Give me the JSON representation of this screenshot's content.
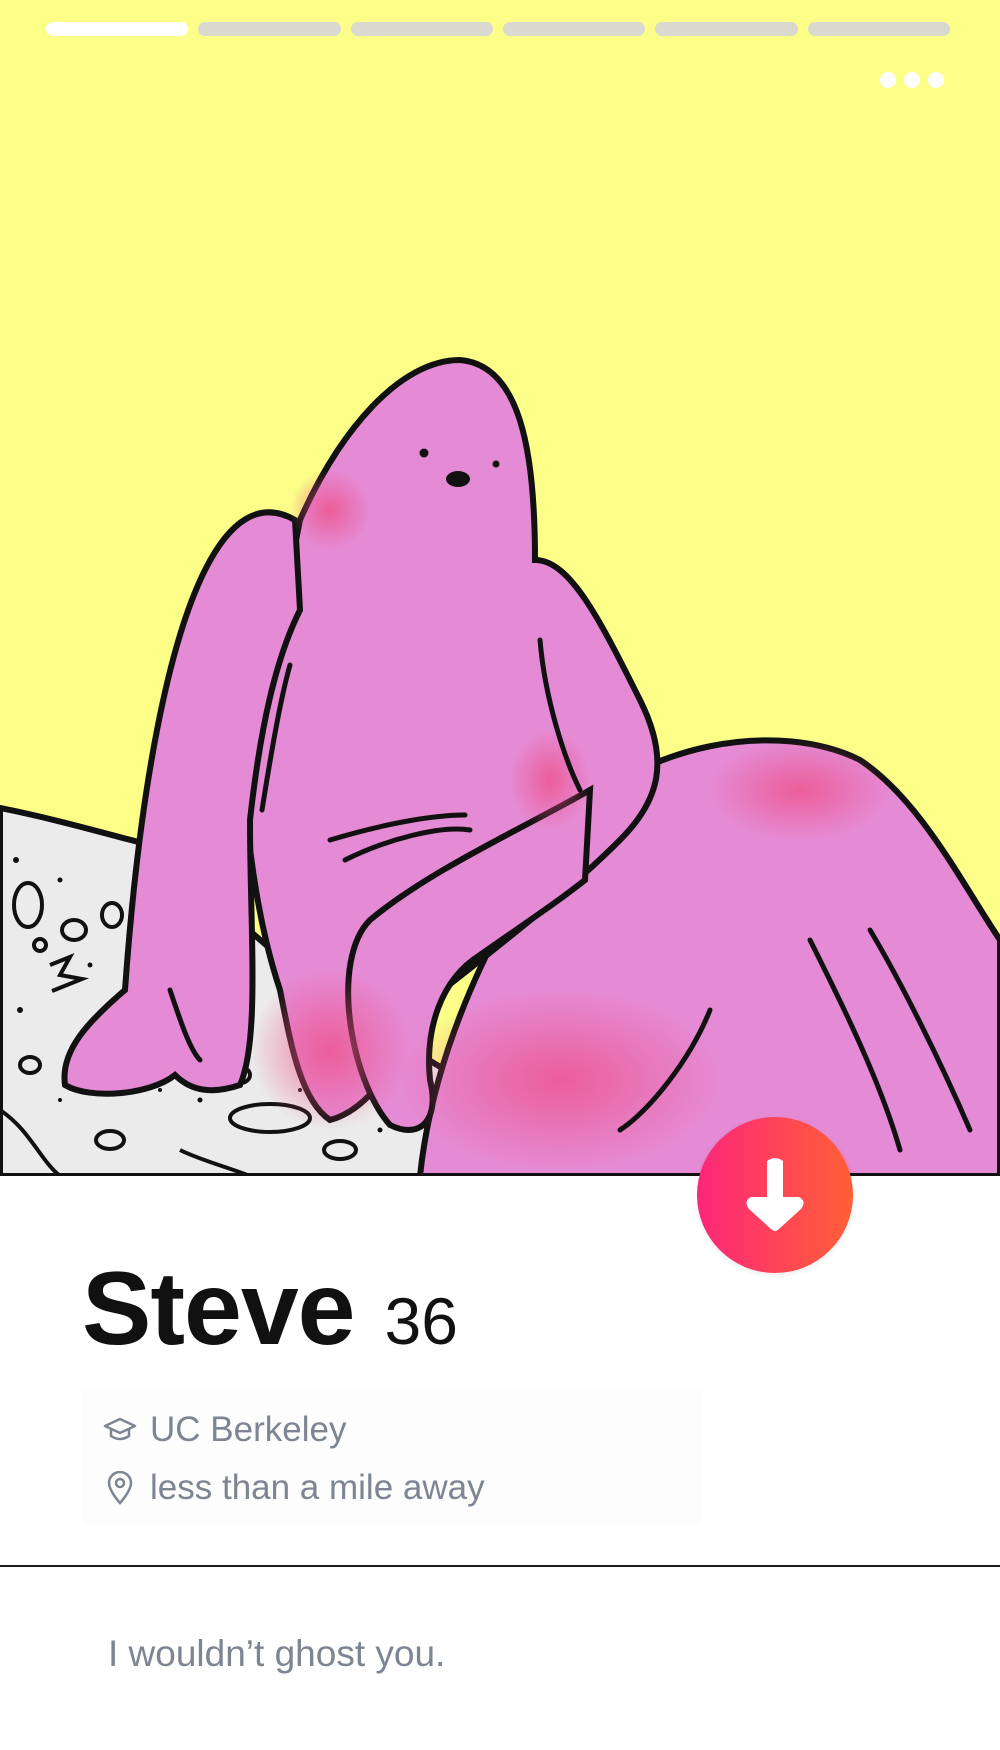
{
  "profile": {
    "name": "Steve",
    "age": "36",
    "school": "UC Berkeley",
    "distance": "less than a mile away",
    "bio": "I wouldn’t ghost you."
  },
  "photo": {
    "current": 1,
    "total": 6,
    "background_color": "#fbff88",
    "subject_color": "#e58ad4"
  },
  "icons": {
    "more": "more-dots-icon",
    "collapse": "arrow-down-icon",
    "school": "graduation-cap-icon",
    "location": "location-pin-icon"
  },
  "colors": {
    "accent_start": "#fd267a",
    "accent_end": "#ff6036",
    "secondary_text": "#7c8591"
  }
}
